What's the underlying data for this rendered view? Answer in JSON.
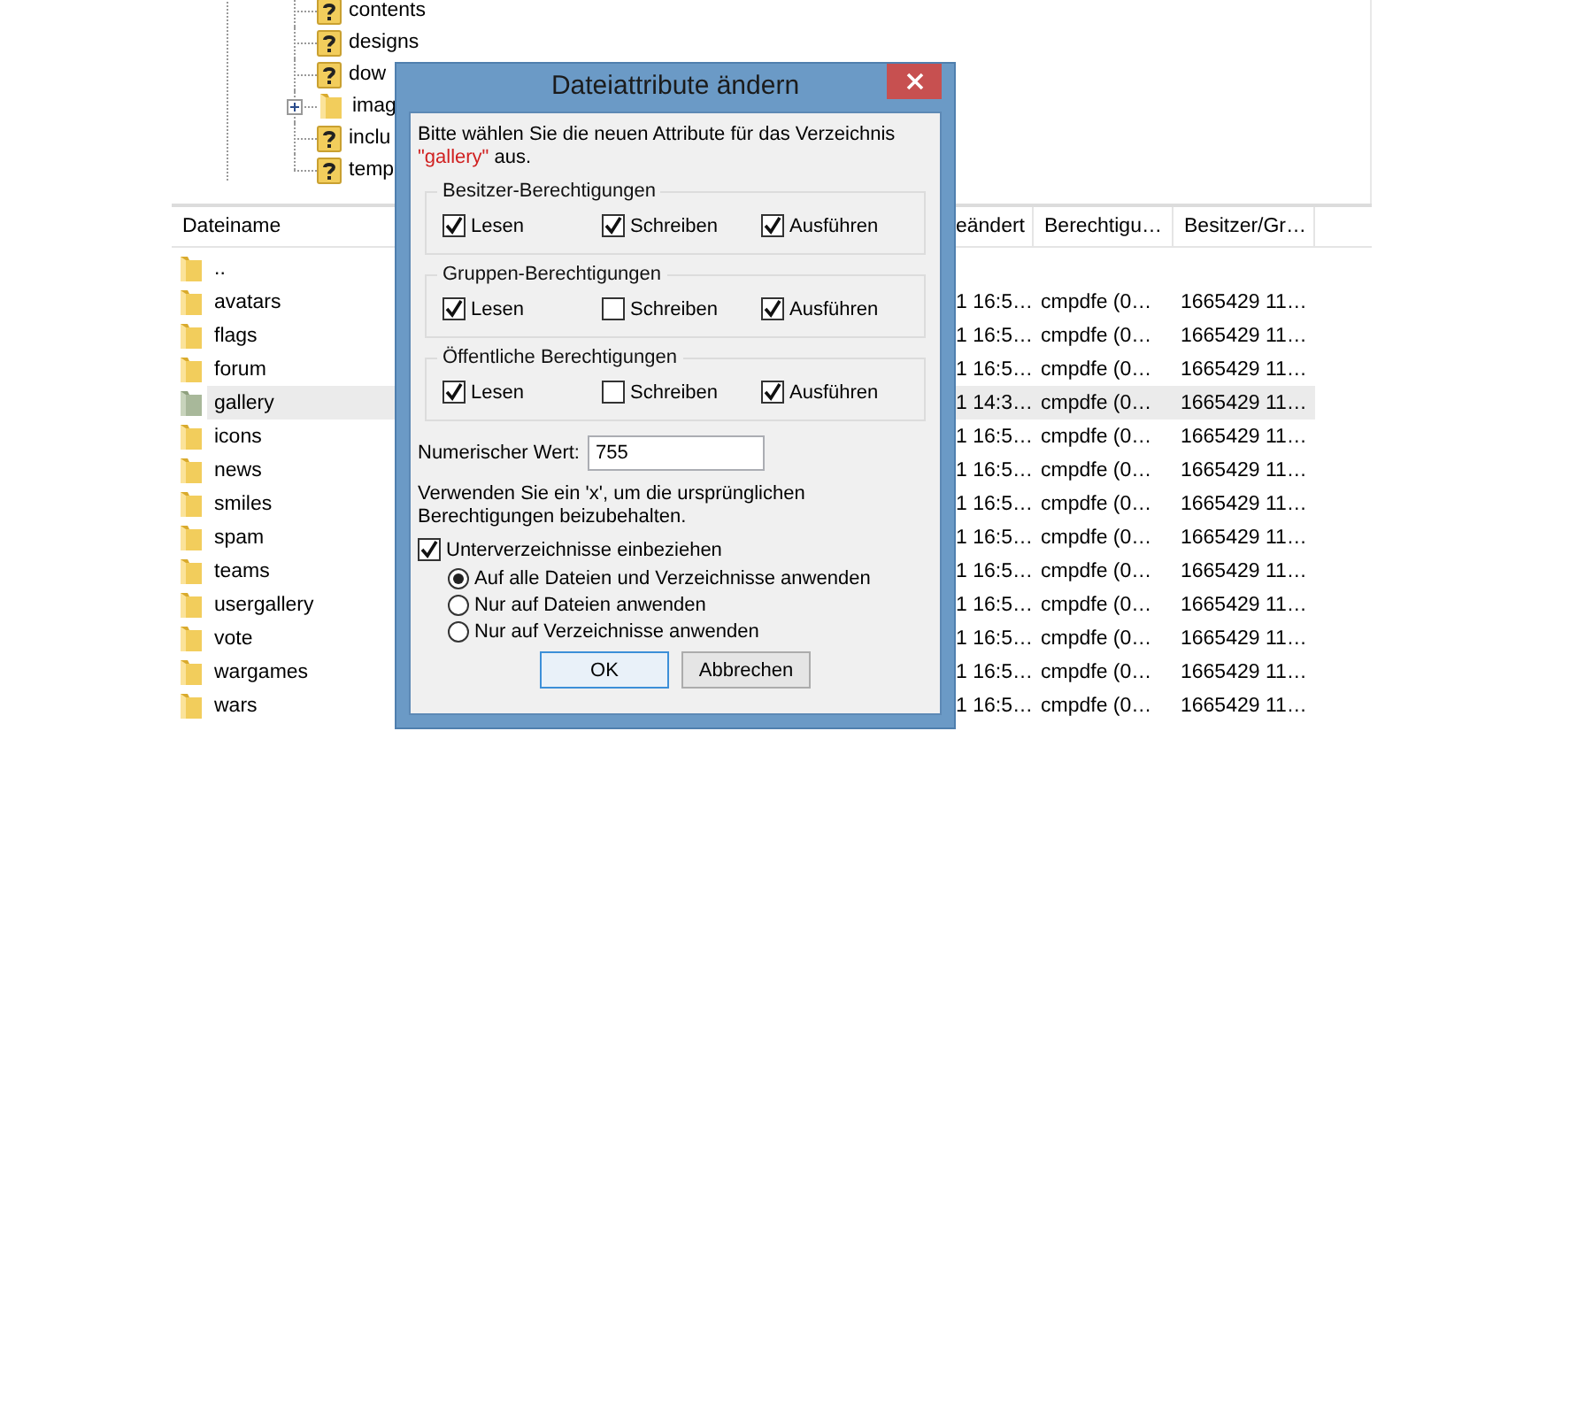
{
  "tree": {
    "items": [
      {
        "label": "contents",
        "kind": "unknown",
        "expandable": false
      },
      {
        "label": "designs",
        "kind": "unknown",
        "expandable": false
      },
      {
        "label": "dow",
        "kind": "unknown",
        "expandable": false
      },
      {
        "label": "imag",
        "kind": "folder",
        "expandable": true
      },
      {
        "label": "inclu",
        "kind": "unknown",
        "expandable": false
      },
      {
        "label": "temp",
        "kind": "unknown",
        "expandable": false
      }
    ]
  },
  "file_list": {
    "columns": [
      "Dateiname",
      "eändert",
      "Berechtigu…",
      "Besitzer/Gr…"
    ],
    "rows": [
      {
        "name": "..",
        "selected": false
      },
      {
        "name": "avatars",
        "modified": "1 16:5…",
        "permissions": "cmpdfe (0…",
        "owner": "1665429 11…",
        "selected": false
      },
      {
        "name": "flags",
        "modified": "1 16:5…",
        "permissions": "cmpdfe (0…",
        "owner": "1665429 11…",
        "selected": false
      },
      {
        "name": "forum",
        "modified": "1 16:5…",
        "permissions": "cmpdfe (0…",
        "owner": "1665429 11…",
        "selected": false
      },
      {
        "name": "gallery",
        "modified": "1 14:3…",
        "permissions": "cmpdfe (0…",
        "owner": "1665429 11…",
        "selected": true
      },
      {
        "name": "icons",
        "modified": "1 16:5…",
        "permissions": "cmpdfe (0…",
        "owner": "1665429 11…",
        "selected": false
      },
      {
        "name": "news",
        "modified": "1 16:5…",
        "permissions": "cmpdfe (0…",
        "owner": "1665429 11…",
        "selected": false
      },
      {
        "name": "smiles",
        "modified": "1 16:5…",
        "permissions": "cmpdfe (0…",
        "owner": "1665429 11…",
        "selected": false
      },
      {
        "name": "spam",
        "modified": "1 16:5…",
        "permissions": "cmpdfe (0…",
        "owner": "1665429 11…",
        "selected": false
      },
      {
        "name": "teams",
        "modified": "1 16:5…",
        "permissions": "cmpdfe (0…",
        "owner": "1665429 11…",
        "selected": false
      },
      {
        "name": "usergallery",
        "modified": "1 16:5…",
        "permissions": "cmpdfe (0…",
        "owner": "1665429 11…",
        "selected": false
      },
      {
        "name": "vote",
        "modified": "1 16:5…",
        "permissions": "cmpdfe (0…",
        "owner": "1665429 11…",
        "selected": false
      },
      {
        "name": "wargames",
        "modified": "1 16:5…",
        "permissions": "cmpdfe (0…",
        "owner": "1665429 11…",
        "selected": false
      },
      {
        "name": "wars",
        "modified": "1 16:5…",
        "permissions": "cmpdfe (0…",
        "owner": "1665429 11…",
        "selected": false
      }
    ]
  },
  "dialog": {
    "title": "Dateiattribute ändern",
    "intro": {
      "before": "Bitte wählen Sie die neuen Attribute für das Verzeichnis ",
      "name": "\"gallery\"",
      "after": " aus."
    },
    "groups": [
      {
        "title": "Besitzer-Berechtigungen",
        "options": [
          {
            "label": "Lesen",
            "checked": true
          },
          {
            "label": "Schreiben",
            "checked": true
          },
          {
            "label": "Ausführen",
            "checked": true
          }
        ]
      },
      {
        "title": "Gruppen-Berechtigungen",
        "options": [
          {
            "label": "Lesen",
            "checked": true
          },
          {
            "label": "Schreiben",
            "checked": false
          },
          {
            "label": "Ausführen",
            "checked": true
          }
        ]
      },
      {
        "title": "Öffentliche Berechtigungen",
        "options": [
          {
            "label": "Lesen",
            "checked": true
          },
          {
            "label": "Schreiben",
            "checked": false
          },
          {
            "label": "Ausführen",
            "checked": true
          }
        ]
      }
    ],
    "numeric": {
      "label": "Numerischer Wert:",
      "value": "755"
    },
    "hint": "Verwenden Sie ein 'x', um die ursprünglichen Berechtigungen beizubehalten.",
    "subdirectories": {
      "label": "Unterverzeichnisse einbeziehen",
      "checked": true
    },
    "apply_options": [
      {
        "label": "Auf alle Dateien und Verzeichnisse anwenden",
        "selected": true
      },
      {
        "label": "Nur auf Dateien anwenden",
        "selected": false
      },
      {
        "label": "Nur auf Verzeichnisse anwenden",
        "selected": false
      }
    ],
    "buttons": [
      {
        "label": "OK",
        "default": true
      },
      {
        "label": "Abbrechen",
        "default": false
      }
    ]
  }
}
